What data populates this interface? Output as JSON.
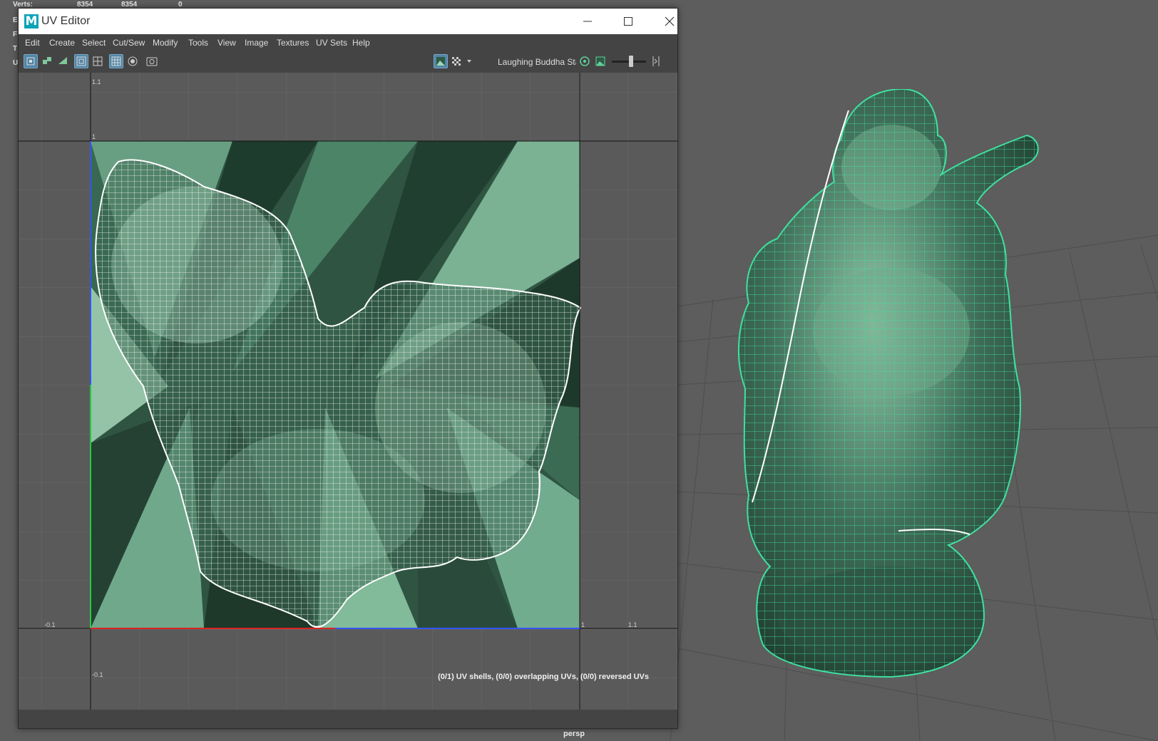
{
  "hud": {
    "rows": [
      {
        "label": "Verts:",
        "values": [
          "8354",
          "8354",
          "0"
        ]
      },
      {
        "label": "E",
        "values": []
      },
      {
        "label": "F",
        "values": []
      },
      {
        "label": "T",
        "values": []
      },
      {
        "label": "U",
        "values": []
      }
    ]
  },
  "viewport": {
    "camera": "persp"
  },
  "uv_editor": {
    "app_logo": "M",
    "title": "UV Editor",
    "window_buttons": {
      "minimize": "minimize-icon",
      "maximize": "maximize-icon",
      "close": "close-icon"
    },
    "menu": [
      "Edit",
      "Create",
      "Select",
      "Cut/Sew",
      "Modify",
      "Tools",
      "View",
      "Image",
      "Textures",
      "UV Sets",
      "Help"
    ],
    "toolbar": {
      "image_name": "Laughing Buddha Sta",
      "icons": [
        "uv-shell-icon",
        "uv-component-icon",
        "uv-edge-icon",
        "frame-icon",
        "grid-border-icon",
        "grid-icon",
        "snap-icon",
        "camera-snapshot-icon",
        "image-display-icon",
        "checker-icon",
        "dropdown-arrow-icon",
        "uv-distortion-icon",
        "image-icon",
        "exposure-slider-icon",
        "expand-icon"
      ]
    },
    "axis_labels": {
      "top_v": "1.1",
      "one_v": "1",
      "left_u": "-0.1",
      "one_u": "1",
      "right_u": "1.1",
      "bottom_v": "-0.1"
    },
    "status": "(0/1) UV shells, (0/0) overlapping UVs, (0/0) reversed UVs"
  },
  "colors": {
    "viewport_bg": "#5d5d5d",
    "uv_bg": "#5a5a5a",
    "texture_dark": "#1f3a2c",
    "texture_light": "#7fbf9c",
    "wireframe_uv": "#ffffff",
    "wireframe_3d": "#3fe0a0",
    "accent": "#5285a6"
  }
}
